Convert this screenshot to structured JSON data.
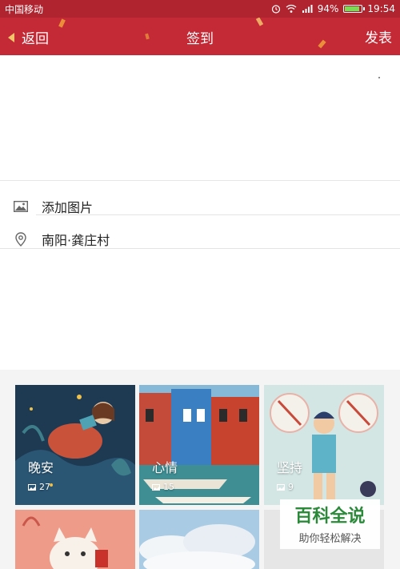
{
  "status_bar": {
    "carrier": "中国移动",
    "battery": "94%",
    "time": "19:54",
    "icons": [
      "alarm-icon",
      "wifi-icon",
      "signal-icon",
      "battery-icon"
    ]
  },
  "header": {
    "back_label": "返回",
    "title": "签到",
    "publish_label": "发表",
    "color": "#c42a35"
  },
  "composer": {
    "add_image_label": "添加图片",
    "location_label": "南阳·龚庄村"
  },
  "gallery": {
    "cards": [
      {
        "name": "晚安",
        "count": "27"
      },
      {
        "name": "心情",
        "count": "15"
      },
      {
        "name": "坚持",
        "count": "9"
      },
      {
        "name": "",
        "count": ""
      },
      {
        "name": "",
        "count": ""
      },
      {
        "name": "",
        "count": ""
      }
    ]
  },
  "watermark": {
    "main": "百科全说",
    "sub": "助你轻松解决"
  }
}
